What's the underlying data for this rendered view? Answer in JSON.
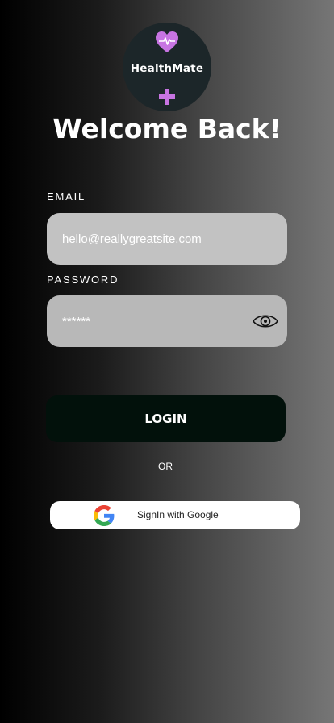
{
  "app": {
    "logo_text": "HealthMate"
  },
  "title": "Welcome Back!",
  "email": {
    "label": "EMAIL",
    "value": "hello@reallygreatsite.com"
  },
  "password": {
    "label": "PASSWORD",
    "value": "******",
    "toggle_icon": "eye-icon"
  },
  "login": {
    "label": "LOGIN"
  },
  "separator": "OR",
  "google": {
    "label": "SignIn with Google",
    "icon": "google-icon"
  },
  "colors": {
    "accent": "#c774e2",
    "login_button": "#02110b",
    "logo_bg": "#1c2629"
  }
}
